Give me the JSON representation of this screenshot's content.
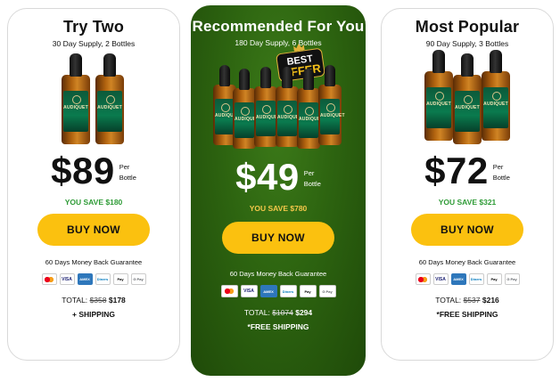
{
  "cards": [
    {
      "title": "Try Two",
      "supply": "30 Day Supply, 2 Bottles",
      "bottle_label": "AUDIQUET",
      "price": "$89",
      "per_1": "Per",
      "per_2": "Bottle",
      "save": "YOU SAVE $180",
      "buy": "BUY NOW",
      "guarantee": "60 Days Money Back Guarantee",
      "total_label": "TOTAL:",
      "total_old": "$358",
      "total_new": "$178",
      "shipping": "+ SHIPPING"
    },
    {
      "title": "Recommended For You",
      "supply": "180 Day Supply, 6 Bottles",
      "badge_line1": "BEST",
      "badge_line2": "OFFER",
      "bottle_label": "AUDIQUET",
      "price": "$49",
      "per_1": "Per",
      "per_2": "Bottle",
      "save": "YOU SAVE $780",
      "buy": "BUY NOW",
      "guarantee": "60 Days Money Back Guarantee",
      "total_label": "TOTAL:",
      "total_old": "$1074",
      "total_new": "$294",
      "shipping": "*FREE SHIPPING"
    },
    {
      "title": "Most Popular",
      "supply": "90 Day Supply, 3 Bottles",
      "bottle_label": "AUDIQUET",
      "price": "$72",
      "per_1": "Per",
      "per_2": "Bottle",
      "save": "YOU SAVE $321",
      "buy": "BUY NOW",
      "guarantee": "60 Days Money Back Guarantee",
      "total_label": "TOTAL:",
      "total_old": "$537",
      "total_new": "$216",
      "shipping": "*FREE SHIPPING"
    }
  ],
  "payment_icons": {
    "mastercard": "",
    "visa": "VISA",
    "amex": "AMEX",
    "diners": "Diners",
    "apple": "Pay",
    "gpay": "G Pay"
  },
  "colors": {
    "accent_button": "#fbc10f",
    "save_green": "#2e9b36",
    "mid_card": "#2d6410",
    "mid_save": "#f5c84a"
  }
}
